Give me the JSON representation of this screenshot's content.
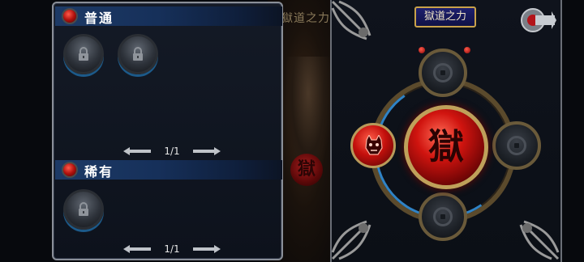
{
  "left_panel": {
    "normal": {
      "title": "普通",
      "page": "1/1",
      "slots": [
        "locked",
        "locked"
      ]
    },
    "rare": {
      "title": "稀有",
      "page": "1/1",
      "slots": [
        "locked"
      ]
    }
  },
  "scene": {
    "title": "獄道之力",
    "gem_glyph": "獄"
  },
  "right_panel": {
    "title": "獄道之力",
    "center_glyph": "獄",
    "slots": [
      "top",
      "right",
      "bottom"
    ],
    "accent_colors": {
      "gold": "#c9a24a",
      "red": "#d0140f",
      "blue": "#2f83c6"
    }
  },
  "icons": [
    "lock-icon",
    "arrow-left-icon",
    "arrow-right-icon",
    "back-icon",
    "demon-mask-icon",
    "ornament-icon"
  ]
}
